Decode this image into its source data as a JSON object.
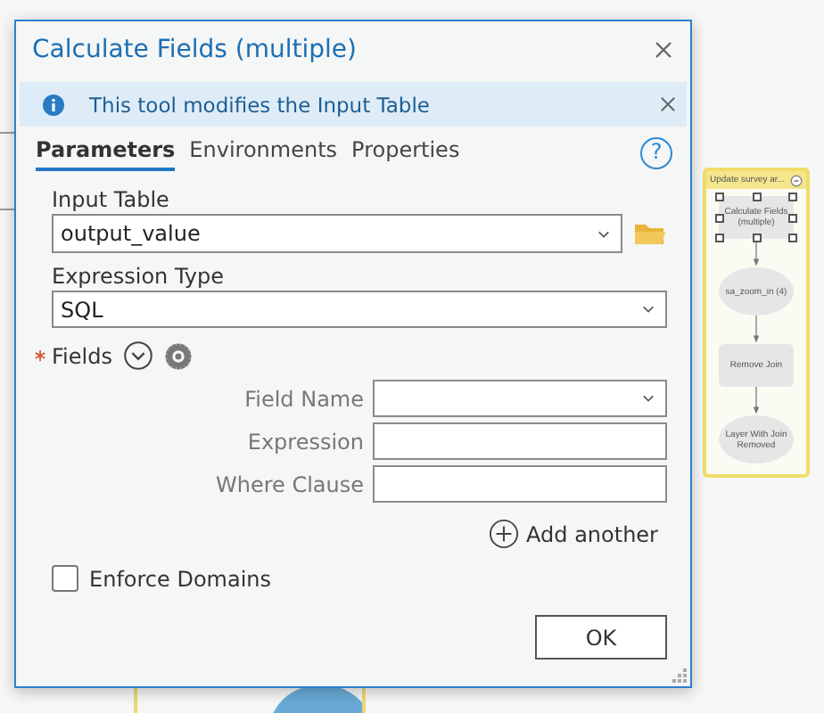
{
  "model": {
    "group_title": "Update survey ar...",
    "nodes": [
      {
        "label": "Calculate Fields (multiple)",
        "kind": "tool",
        "selected": true
      },
      {
        "label": "sa_zoom_in (4)",
        "kind": "variable",
        "selected": false
      },
      {
        "label": "Remove Join",
        "kind": "tool",
        "selected": false
      },
      {
        "label": "Layer With Join Removed",
        "kind": "variable",
        "selected": false
      }
    ]
  },
  "dialog": {
    "title": "Calculate Fields (multiple)",
    "info": "This tool modifies the Input Table",
    "help": "?",
    "tabs": [
      {
        "label": "Parameters",
        "selected": true
      },
      {
        "label": "Environments",
        "selected": false
      },
      {
        "label": "Properties",
        "selected": false
      }
    ],
    "input_table": {
      "label": "Input Table",
      "value": "output_value"
    },
    "expression_type": {
      "label": "Expression Type",
      "value": "SQL"
    },
    "fields": {
      "label": "Fields",
      "required": true,
      "rows": [
        {
          "label": "Field Name",
          "kind": "dropdown"
        },
        {
          "label": "Expression",
          "kind": "text"
        },
        {
          "label": "Where Clause",
          "kind": "text"
        }
      ],
      "add_label": "Add another"
    },
    "enforce_domains": {
      "label": "Enforce Domains",
      "checked": false
    },
    "ok_button": "OK"
  }
}
